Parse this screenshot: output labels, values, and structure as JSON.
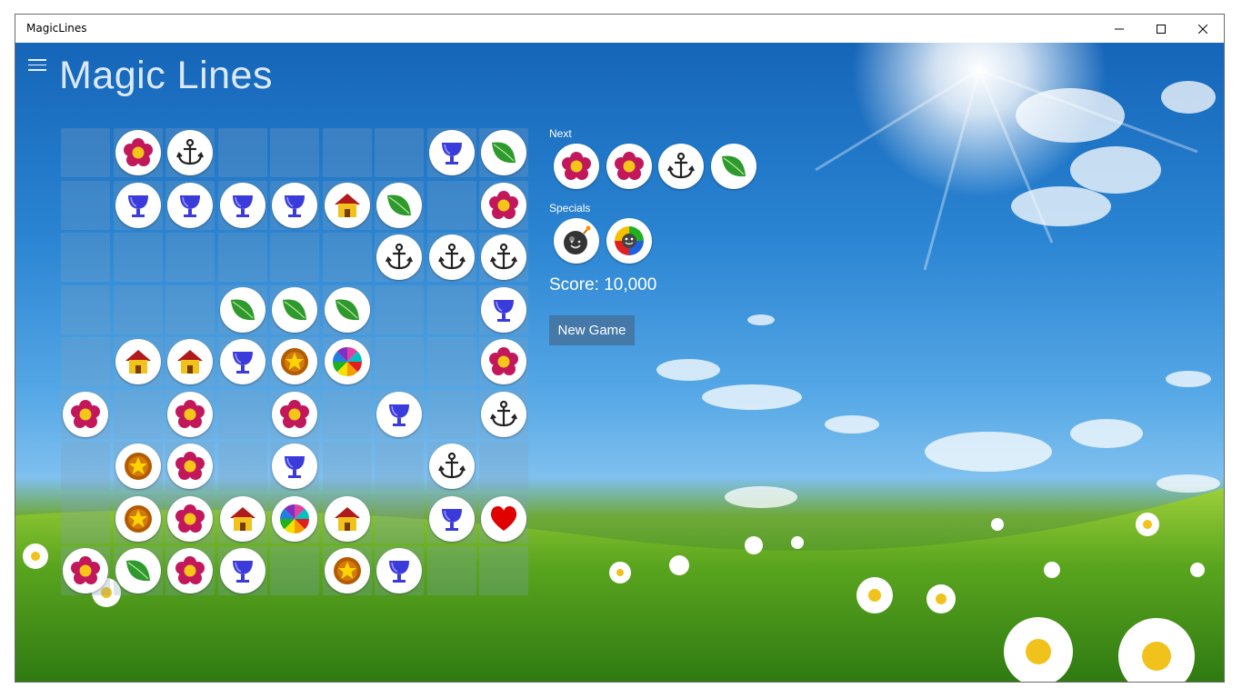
{
  "window": {
    "title": "MagicLines"
  },
  "app": {
    "title": "Magic Lines"
  },
  "board": {
    "rows": 9,
    "cols": 9,
    "cells": [
      [
        "",
        "flower",
        "anchor",
        "",
        "",
        "",
        "",
        "cup",
        "leaf"
      ],
      [
        "",
        "cup",
        "cup",
        "cup",
        "cup",
        "house",
        "leaf",
        "",
        "flower"
      ],
      [
        "",
        "",
        "",
        "",
        "",
        "",
        "anchor",
        "anchor",
        "anchor"
      ],
      [
        "",
        "",
        "",
        "leaf",
        "leaf",
        "leaf",
        "",
        "",
        "cup"
      ],
      [
        "",
        "house",
        "house",
        "cup",
        "star",
        "wheel",
        "",
        "",
        "flower"
      ],
      [
        "flower",
        "",
        "flower",
        "",
        "flower",
        "",
        "cup",
        "",
        "anchor"
      ],
      [
        "",
        "star",
        "flower",
        "",
        "cup",
        "",
        "",
        "anchor",
        ""
      ],
      [
        "",
        "star",
        "flower",
        "house",
        "wheel",
        "house",
        "",
        "cup",
        "heart"
      ],
      [
        "flower",
        "leaf",
        "flower",
        "cup",
        "",
        "star",
        "cup",
        "",
        ""
      ]
    ]
  },
  "next": {
    "label": "Next",
    "balls": [
      "flower",
      "flower",
      "anchor",
      "leaf"
    ]
  },
  "specials": {
    "label": "Specials",
    "balls": [
      "bomb",
      "rainbow"
    ]
  },
  "score": {
    "text": "Score: 10,000"
  },
  "new_game": {
    "label": "New Game"
  },
  "colors": {
    "flower_petal": "#c2185b",
    "flower_center": "#f5c518",
    "cup": "#3b3bdc",
    "leaf": "#2e9a2e",
    "house_wall": "#f2c21c",
    "house_roof": "#b11a1a",
    "star_ring": "#b35b00",
    "star": "#ffd400",
    "heart": "#e00000",
    "anchor": "#222222"
  }
}
